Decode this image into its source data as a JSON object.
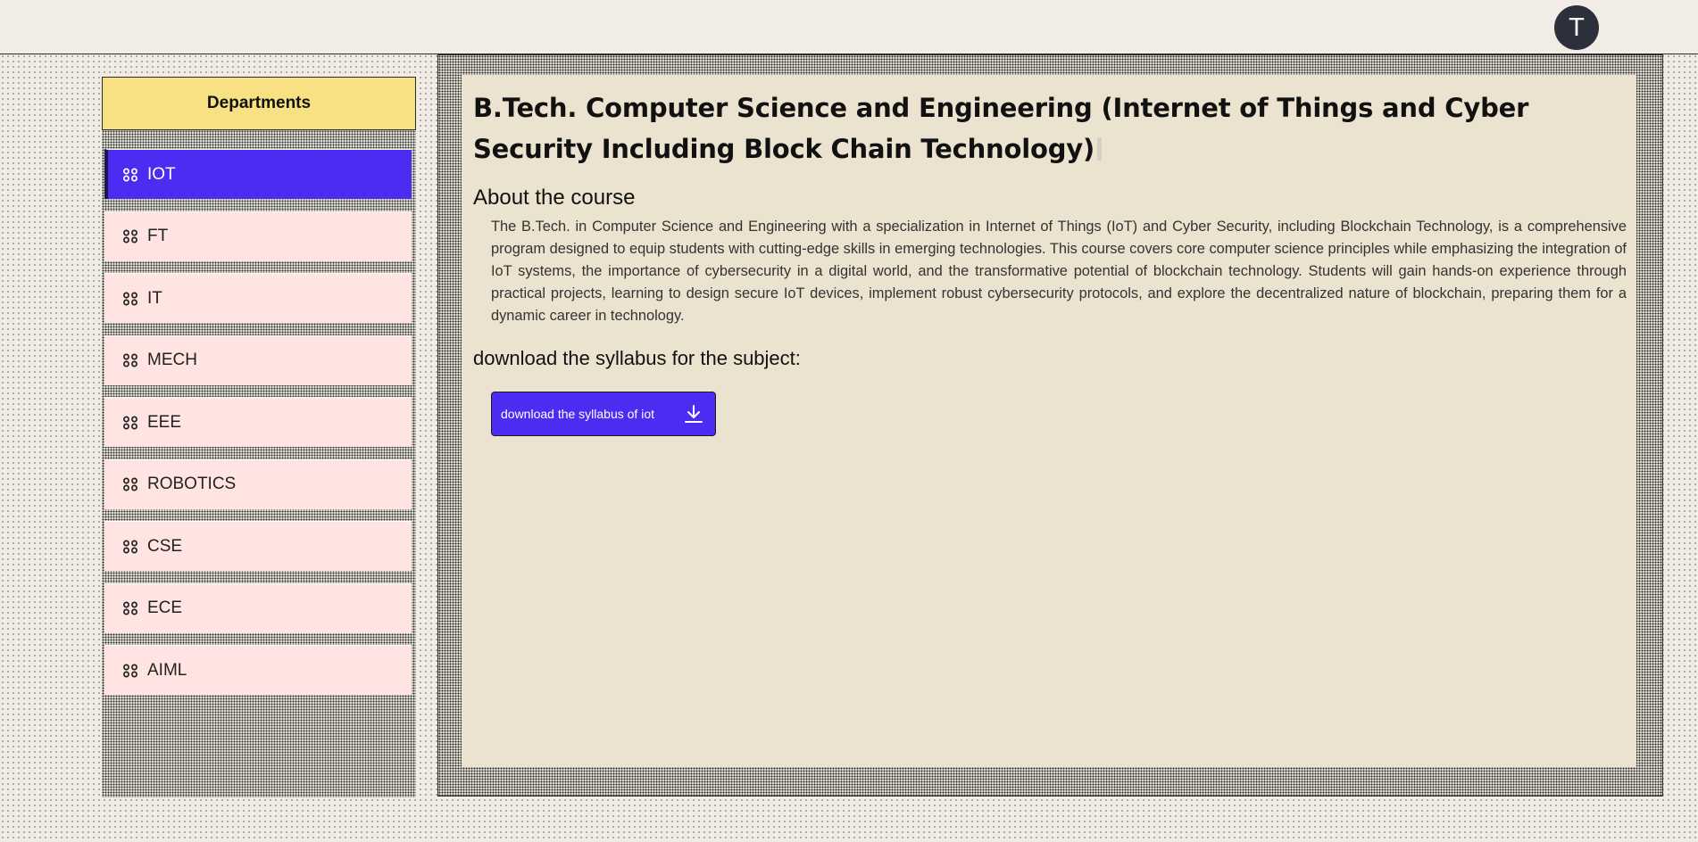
{
  "header": {
    "avatar_initial": "T"
  },
  "sidebar": {
    "title": "Departments",
    "items": [
      {
        "label": "IOT",
        "active": true
      },
      {
        "label": "FT"
      },
      {
        "label": "IT"
      },
      {
        "label": "MECH"
      },
      {
        "label": "EEE"
      },
      {
        "label": "ROBOTICS"
      },
      {
        "label": "CSE"
      },
      {
        "label": "ECE"
      },
      {
        "label": "AIML"
      }
    ],
    "item_icon": "group-icon"
  },
  "main": {
    "title": "B.Tech. Computer Science and Engineering (Internet of Things and Cyber Security Including Block Chain Technology)",
    "about_heading": "About the course",
    "about_text": "The B.Tech. in Computer Science and Engineering with a specialization in Internet of Things (IoT) and Cyber Security, including Blockchain Technology, is a comprehensive program designed to equip students with cutting-edge skills in emerging technologies. This course covers core computer science principles while emphasizing the integration of IoT systems, the importance of cybersecurity in a digital world, and the transformative potential of blockchain technology. Students will gain hands-on experience through practical projects, learning to design secure IoT devices, implement robust cybersecurity protocols, and explore the decentralized nature of blockchain, preparing them for a dynamic career in technology.",
    "syllabus_label": "download the syllabus for the subject:",
    "download_button": {
      "label": "download the syllabus of iot",
      "icon": "download-icon"
    }
  },
  "colors": {
    "accent": "#4b2cf0",
    "header_yellow": "#f7e183",
    "item_pink": "#ffe4e1",
    "content_bg": "#ebe3cf",
    "avatar_bg": "#2b303a"
  }
}
